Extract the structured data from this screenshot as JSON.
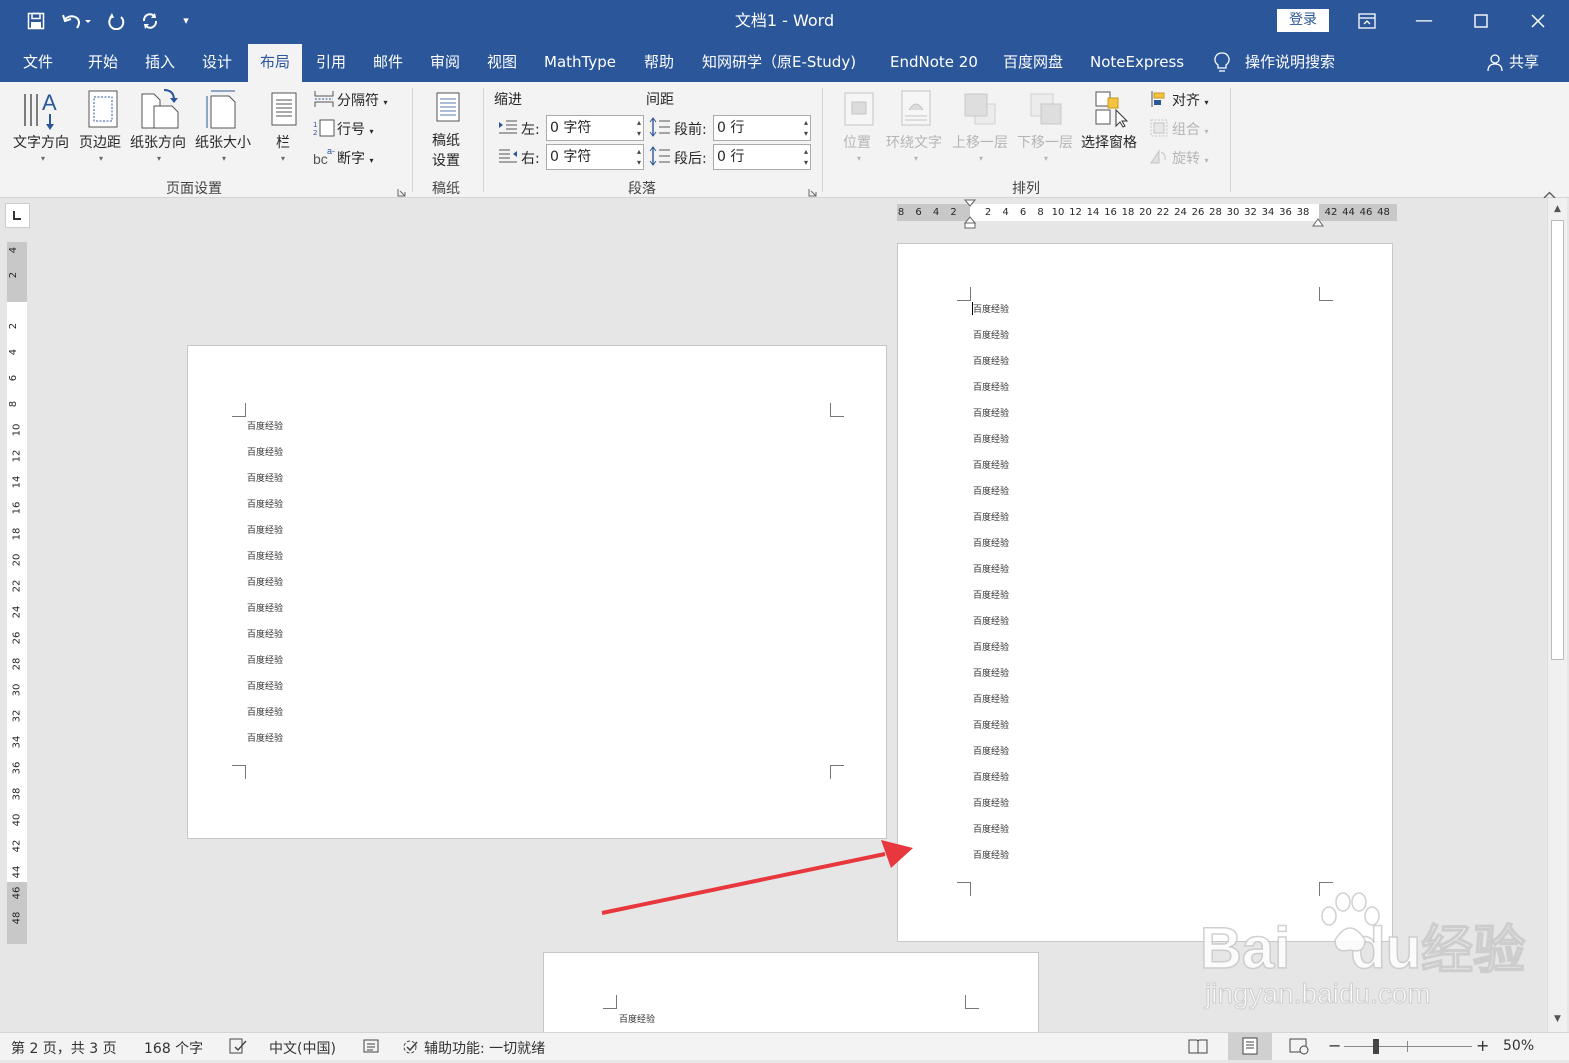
{
  "window": {
    "title": "文档1 - Word",
    "login_label": "登录",
    "share_label": "共享"
  },
  "tabs": [
    {
      "label": "文件"
    },
    {
      "label": "开始"
    },
    {
      "label": "插入"
    },
    {
      "label": "设计"
    },
    {
      "label": "布局"
    },
    {
      "label": "引用"
    },
    {
      "label": "邮件"
    },
    {
      "label": "审阅"
    },
    {
      "label": "视图"
    },
    {
      "label": "MathType"
    },
    {
      "label": "帮助"
    },
    {
      "label": "知网研学（原E-Study)"
    },
    {
      "label": "EndNote 20"
    },
    {
      "label": "百度网盘"
    },
    {
      "label": "NoteExpress"
    },
    {
      "label": "操作说明搜索"
    }
  ],
  "ribbon": {
    "page_setup": {
      "text_direction": "文字方向",
      "margins": "页边距",
      "orientation": "纸张方向",
      "size": "纸张大小",
      "columns": "栏",
      "breaks": "分隔符",
      "line_numbers": "行号",
      "hyphenation": "断字",
      "group_label": "页面设置"
    },
    "draft": {
      "button_line1": "稿纸",
      "button_line2": "设置",
      "group_label": "稿纸"
    },
    "paragraph": {
      "indent_title": "缩进",
      "spacing_title": "间距",
      "left_label": "左:",
      "left_value": "0 字符",
      "right_label": "右:",
      "right_value": "0 字符",
      "before_label": "段前:",
      "before_value": "0 行",
      "after_label": "段后:",
      "after_value": "0 行",
      "group_label": "段落"
    },
    "arrange": {
      "position": "位置",
      "wrap_text": "环绕文字",
      "bring_forward": "上移一层",
      "send_backward": "下移一层",
      "selection_pane": "选择窗格",
      "align": "对齐",
      "group": "组合",
      "rotate": "旋转",
      "group_label": "排列"
    }
  },
  "ruler": {
    "h_left": [
      "8",
      "6",
      "4",
      "2"
    ],
    "h_right": [
      "2",
      "4",
      "6",
      "8",
      "10",
      "12",
      "14",
      "16",
      "18",
      "20",
      "22",
      "24",
      "26",
      "28",
      "30",
      "32",
      "34",
      "36",
      "38"
    ],
    "h_far": [
      "42",
      "44",
      "46",
      "48"
    ],
    "v_top": [
      "4",
      "2"
    ],
    "v_main": [
      "2",
      "4",
      "6",
      "8",
      "10",
      "12",
      "14",
      "16",
      "18",
      "20",
      "22",
      "24",
      "26",
      "28",
      "30",
      "32",
      "34",
      "36",
      "38",
      "40",
      "42",
      "44"
    ],
    "v_bottom": [
      "46",
      "48"
    ]
  },
  "pages": {
    "line_text": "百度经验",
    "page1_line_count": 13,
    "page2_line_count": 22,
    "page3_line_count": 1
  },
  "watermark": {
    "logo_text": "Bai",
    "logo_text2": "du",
    "logo_text3": "经验",
    "url": "jingyan.baidu.com"
  },
  "status": {
    "page_info": "第 2 页，共 3 页",
    "word_count": "168 个字",
    "language": "中文(中国)",
    "accessibility": "辅助功能: 一切就绪",
    "zoom": "50%"
  },
  "colors": {
    "accent": "#2b579a",
    "arrow": "#e8383d"
  }
}
